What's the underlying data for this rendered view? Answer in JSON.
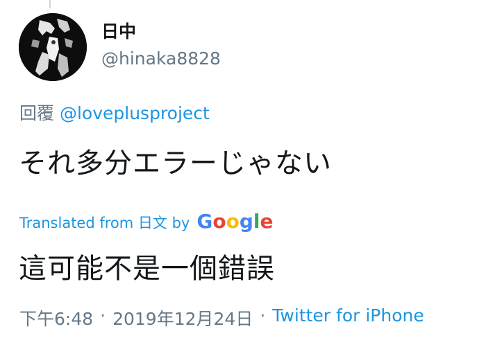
{
  "user": {
    "display_name": "日中",
    "handle": "@hinaka8828"
  },
  "reply": {
    "prefix": "回覆",
    "mention": "@loveplusproject"
  },
  "tweet": {
    "text": "それ多分エラーじゃない"
  },
  "translation": {
    "label": "Translated from 日文 by",
    "provider_letters": [
      "G",
      "o",
      "o",
      "g",
      "l",
      "e"
    ],
    "provider_colors": [
      "#4285F4",
      "#EA4335",
      "#FBBC05",
      "#4285F4",
      "#34A853",
      "#EA4335"
    ],
    "text": "這可能不是一個錯誤"
  },
  "meta": {
    "time": "下午6:48",
    "separator": "·",
    "date": "2019年12月24日",
    "source": "Twitter for iPhone"
  },
  "colors": {
    "link": "#1b95e0",
    "secondary": "#657786",
    "primary_text": "#14171a"
  }
}
